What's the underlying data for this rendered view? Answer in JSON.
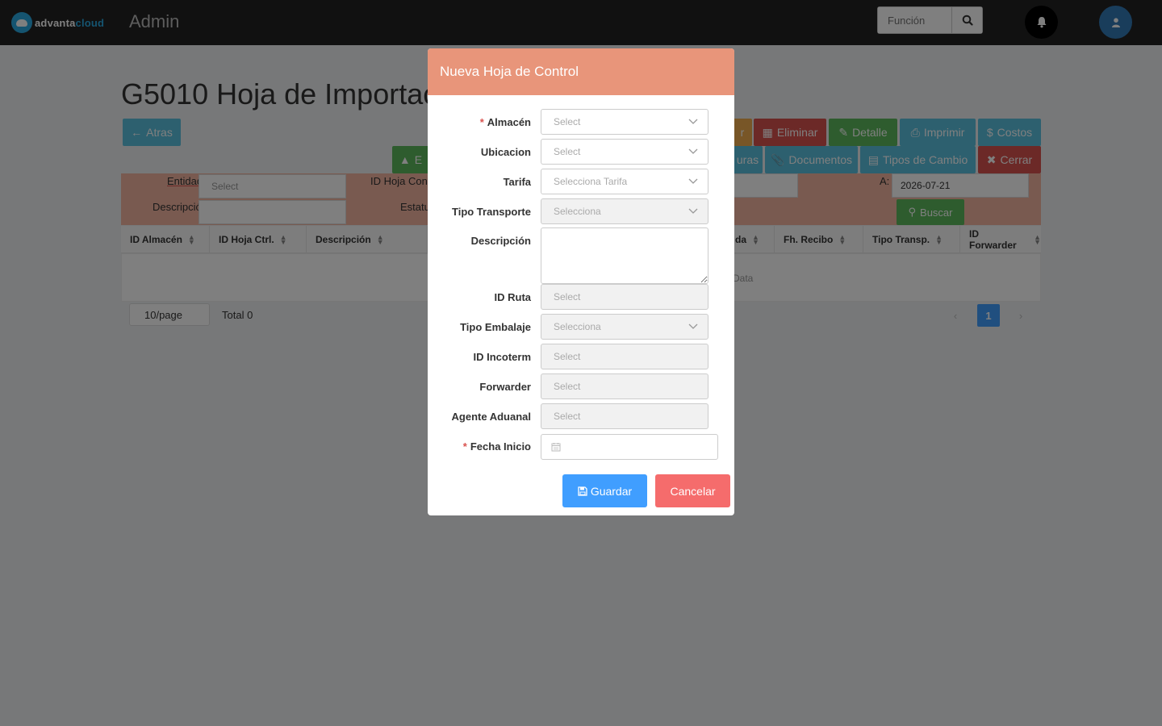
{
  "header": {
    "logo": {
      "part1": "advanta",
      "part2": "cloud"
    },
    "app_title": "Admin",
    "search_placeholder": "Función"
  },
  "page": {
    "title": "G5010 Hoja de Importación",
    "back_label": "Atras",
    "toolbar": {
      "partial_green": "E",
      "partial_orange": "r",
      "eliminar": "Eliminar",
      "detalle": "Detalle",
      "imprimir": "Imprimir",
      "costos": "Costos",
      "facturas_partial": "uras",
      "documentos": "Documentos",
      "tipos_cambio": "Tipos de Cambio",
      "cerrar": "Cerrar"
    },
    "filters": {
      "entidad_label": "Entidad",
      "entidad_placeholder": "Select",
      "id_hoja_label": "ID Hoja Control",
      "descripcion_label": "Descripción",
      "estatus_label": "Estatus",
      "a_label": "A:",
      "a_value": "2026-07-21",
      "buscar_label": "Buscar"
    },
    "table": {
      "columns": [
        "ID Almacén",
        "ID Hoja Ctrl.",
        "Descripción",
        "da",
        "Fh. Recibo",
        "Tipo Transp.",
        "ID Forwarder"
      ],
      "no_data": "Data"
    },
    "pagination": {
      "page_size": "10/page",
      "total": "Total 0",
      "current": "1"
    }
  },
  "modal": {
    "title": "Nueva Hoja de Control",
    "fields": {
      "almacen": {
        "label": "Almacén",
        "placeholder": "Select"
      },
      "ubicacion": {
        "label": "Ubicacion",
        "placeholder": "Select"
      },
      "tarifa": {
        "label": "Tarifa",
        "placeholder": "Selecciona Tarifa"
      },
      "tipo_transporte": {
        "label": "Tipo Transporte",
        "placeholder": "Selecciona"
      },
      "descripcion": {
        "label": "Descripción"
      },
      "id_ruta": {
        "label": "ID Ruta",
        "placeholder": "Select"
      },
      "tipo_embalaje": {
        "label": "Tipo Embalaje",
        "placeholder": "Selecciona"
      },
      "id_incoterm": {
        "label": "ID Incoterm",
        "placeholder": "Select"
      },
      "forwarder": {
        "label": "Forwarder",
        "placeholder": "Select"
      },
      "agente_aduanal": {
        "label": "Agente Aduanal",
        "placeholder": "Select"
      },
      "fecha_inicio": {
        "label": "Fecha Inicio"
      }
    },
    "required_marker": "*",
    "guardar": "Guardar",
    "cancelar": "Cancelar"
  },
  "colors": {
    "modal_header": "#e8957a",
    "primary": "#409eff",
    "cancel": "#f56c6c",
    "filter_panel": "#f2b4a0"
  }
}
